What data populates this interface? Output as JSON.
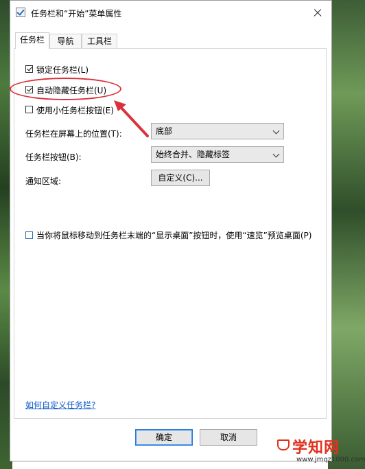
{
  "window": {
    "title": "任务栏和“开始”菜单属性"
  },
  "tabs": [
    {
      "label": "任务栏",
      "active": true
    },
    {
      "label": "导航",
      "active": false
    },
    {
      "label": "工具栏",
      "active": false
    }
  ],
  "options": {
    "lock_taskbar": {
      "label": "锁定任务栏(L)",
      "checked": true
    },
    "auto_hide": {
      "label": "自动隐藏任务栏(U)",
      "checked": true
    },
    "small_buttons": {
      "label": "使用小任务栏按钮(E)",
      "checked": false
    },
    "peek": {
      "label": "当你将鼠标移动到任务栏末端的“显示桌面”按钮时，使用“速览”预览桌面(P)",
      "checked": false
    }
  },
  "position": {
    "label": "任务栏在屏幕上的位置(T):",
    "value": "底部"
  },
  "buttons_setting": {
    "label": "任务栏按钮(B):",
    "value": "始终合并、隐藏标签"
  },
  "notification": {
    "label": "通知区域:",
    "button_label": "自定义(C)..."
  },
  "help_link": "如何自定义任务栏?",
  "footer": {
    "ok_label": "确定",
    "cancel_label": "取消"
  },
  "watermark": {
    "main": "学知网",
    "sub": "www.jmqz1000.com"
  },
  "colors": {
    "annotation": "#d9323a",
    "link": "#0a58c8",
    "focus": "#2a7ad8",
    "watermark": "#e0321d"
  },
  "icons": {
    "title_icon": "taskbar-properties-icon",
    "close": "close-icon",
    "dropdown": "chevron-down-icon"
  }
}
